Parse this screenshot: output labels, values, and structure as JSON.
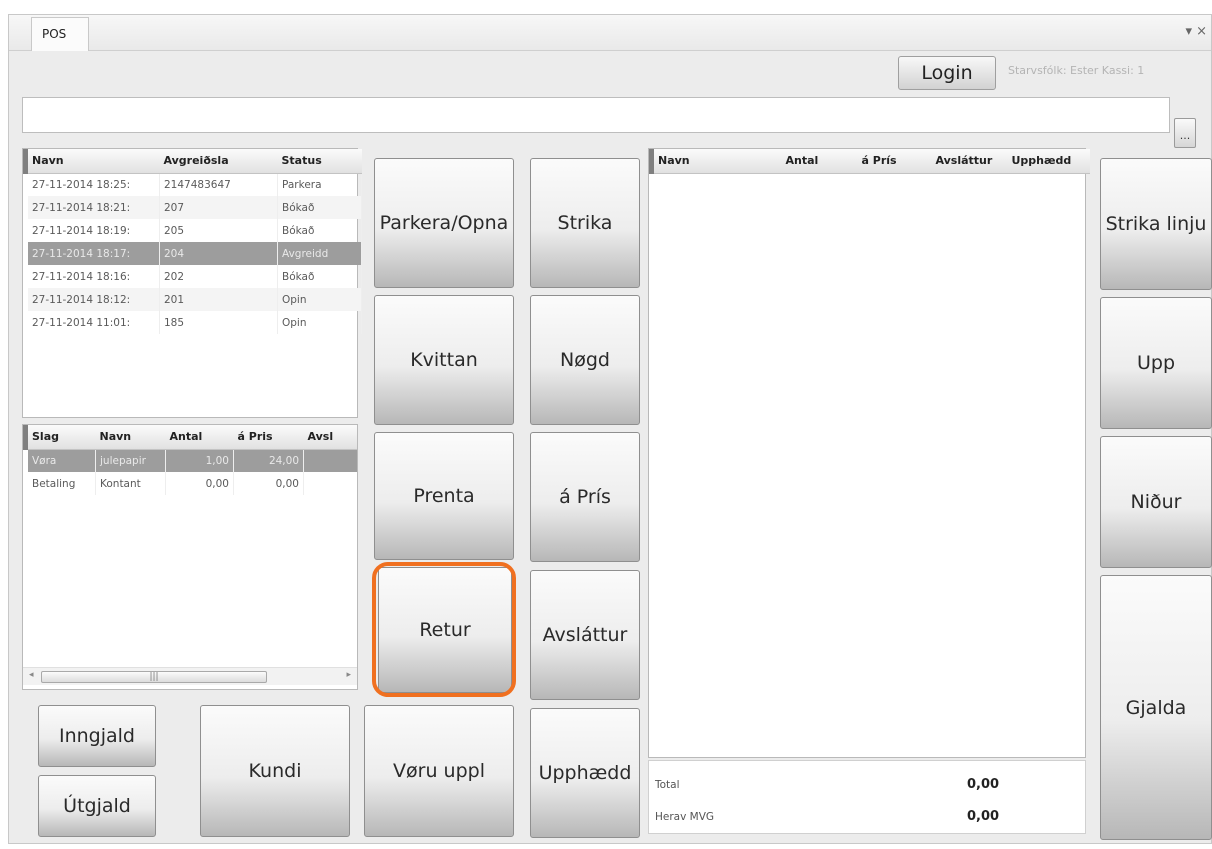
{
  "window": {
    "tab_label": "POS",
    "pin_glyph": "▾ ×"
  },
  "header": {
    "login_label": "Login",
    "staff_text": "Starvsfólk: Ester    Kassi: 1"
  },
  "scan": {
    "value": "",
    "browse_label": "..."
  },
  "orders": {
    "columns": [
      "Navn",
      "Avgreiðsla",
      "Status"
    ],
    "rows": [
      {
        "name": "27-11-2014 18:25:",
        "id": "2147483647",
        "status": "Parkera"
      },
      {
        "name": "27-11-2014 18:21:",
        "id": "207",
        "status": "Bókað"
      },
      {
        "name": "27-11-2014 18:19:",
        "id": "205",
        "status": "Bókað"
      },
      {
        "name": "27-11-2014 18:17:",
        "id": "204",
        "status": "Avgreidd"
      },
      {
        "name": "27-11-2014 18:16:",
        "id": "202",
        "status": "Bókað"
      },
      {
        "name": "27-11-2014 18:12:",
        "id": "201",
        "status": "Opin"
      },
      {
        "name": "27-11-2014 11:01:",
        "id": "185",
        "status": "Opin"
      }
    ]
  },
  "lines": {
    "columns": [
      "Slag",
      "Navn",
      "Antal",
      "á Pris",
      "Avsl"
    ],
    "rows": [
      {
        "type": "Vøra",
        "name": "julepapir",
        "qty": "1,00",
        "price": "24,00",
        "disc": ""
      },
      {
        "type": "Betaling",
        "name": "Kontant",
        "qty": "0,00",
        "price": "0,00",
        "disc": ""
      }
    ],
    "scroll_thumb": "|||"
  },
  "buttons": {
    "inngjald": "Inngjald",
    "utgjald": "Útgjald",
    "kundi": "Kundi",
    "voru_uppl": "Vøru uppl",
    "parkera": "Parkera/Opna",
    "kvittan": "Kvittan",
    "prenta": "Prenta",
    "retur": "Retur",
    "strika": "Strika",
    "nogd": "Nøgd",
    "a_pris": "á Prís",
    "avslattur": "Avsláttur",
    "upphaedd": "Upphædd",
    "strika_linju": "Strika linju",
    "upp": "Upp",
    "nidur": "Niður",
    "gjalda": "Gjalda"
  },
  "items": {
    "columns": [
      "Navn",
      "Antal",
      "á Prís",
      "Avsláttur",
      "Upphædd"
    ]
  },
  "totals": {
    "total_label": "Total",
    "total_value": "0,00",
    "vat_label": "Herav MVG",
    "vat_value": "0,00"
  },
  "colors": {
    "highlight": "#f07020",
    "selected_row": "#9d9d9d"
  }
}
